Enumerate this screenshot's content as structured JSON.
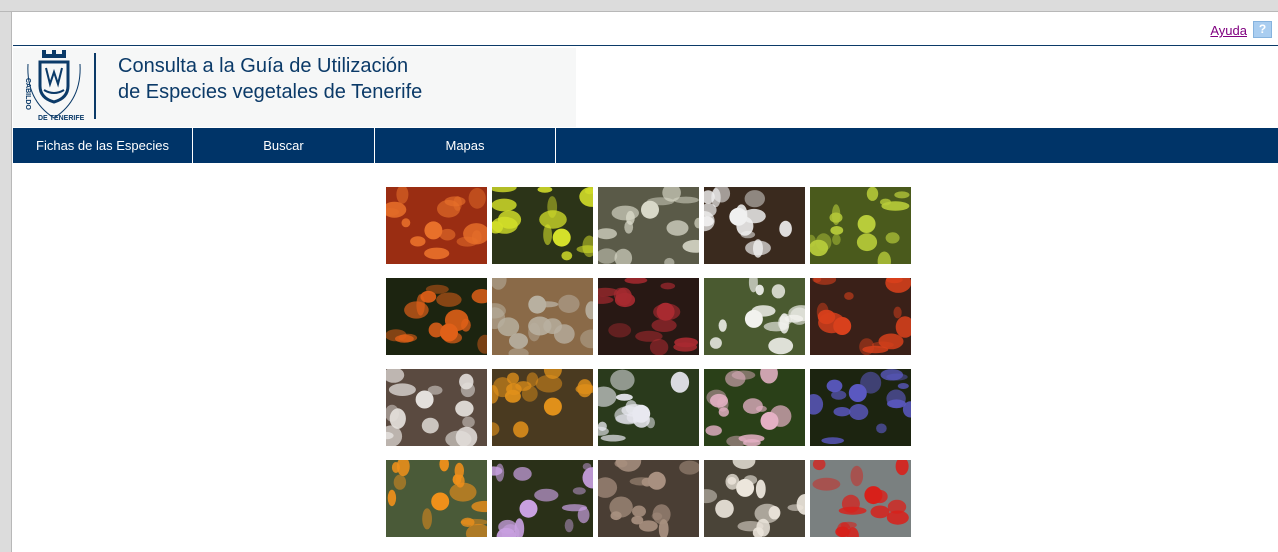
{
  "help": {
    "link_label": "Ayuda",
    "icon_glyph": "?"
  },
  "header": {
    "title_line1": "Consulta a la Guía de Utilización",
    "title_line2": "de Especies vegetales de Tenerife",
    "logo_icon": "cabildo-de-tenerife-crest-icon",
    "logo_text": "CABILDO DE TENERIFE"
  },
  "nav": {
    "items": [
      {
        "label": "Fichas de las Especies"
      },
      {
        "label": "Buscar"
      },
      {
        "label": "Mapas"
      }
    ]
  },
  "colors": {
    "brand_navy": "#003468",
    "title_blue": "#0b3a68",
    "help_link": "#800080",
    "help_icon_bg": "#a9cdf0"
  },
  "gallery": {
    "rows": [
      [
        {
          "icon": "orange-succulent-photo",
          "bg": "#9a2d12",
          "fg": "#e8702a"
        },
        {
          "icon": "yellow-flower-cluster-photo",
          "bg": "#2c3418",
          "fg": "#d4e02a"
        },
        {
          "icon": "white-succulent-rosette-photo",
          "bg": "#5a5a48",
          "fg": "#d8d8c8"
        },
        {
          "icon": "white-daisy-photo",
          "bg": "#3a2a1e",
          "fg": "#f0f0f0"
        },
        {
          "icon": "yellow-green-shrub-photo",
          "bg": "#4a5a1c",
          "fg": "#b8cc3a"
        }
      ],
      [
        {
          "icon": "orange-bellflower-photo",
          "bg": "#1c2410",
          "fg": "#e06018"
        },
        {
          "icon": "rock-plant-photo",
          "bg": "#8a6a48",
          "fg": "#b8b0a0"
        },
        {
          "icon": "red-spotted-flower-photo",
          "bg": "#281814",
          "fg": "#a82a30"
        },
        {
          "icon": "white-daisy-cluster-photo",
          "bg": "#4a5a30",
          "fg": "#f2f2ee"
        },
        {
          "icon": "red-bud-photo",
          "bg": "#3a2018",
          "fg": "#d8401c"
        }
      ],
      [
        {
          "icon": "white-flower-spike-photo",
          "bg": "#5a4a40",
          "fg": "#e4e0dc"
        },
        {
          "icon": "orange-lotus-photo",
          "bg": "#4a3a20",
          "fg": "#e0901a"
        },
        {
          "icon": "small-white-flower-photo",
          "bg": "#2a3a1c",
          "fg": "#e8e8f0"
        },
        {
          "icon": "pink-flower-photo",
          "bg": "#2a4018",
          "fg": "#e4b0c4"
        },
        {
          "icon": "purple-flower-cluster-photo",
          "bg": "#1c2410",
          "fg": "#5a58c0"
        }
      ],
      [
        {
          "icon": "orange-yellow-flowers-photo",
          "bg": "#4a5a38",
          "fg": "#f0901a"
        },
        {
          "icon": "lilac-thistle-photo",
          "bg": "#2a3018",
          "fg": "#c8a0e0"
        },
        {
          "icon": "dry-grey-shrub-photo",
          "bg": "#4a3e34",
          "fg": "#a89080"
        },
        {
          "icon": "white-blossom-photo",
          "bg": "#4a4438",
          "fg": "#ece6dc"
        },
        {
          "icon": "red-beak-flower-photo",
          "bg": "#7a8080",
          "fg": "#d8201a"
        }
      ]
    ]
  }
}
